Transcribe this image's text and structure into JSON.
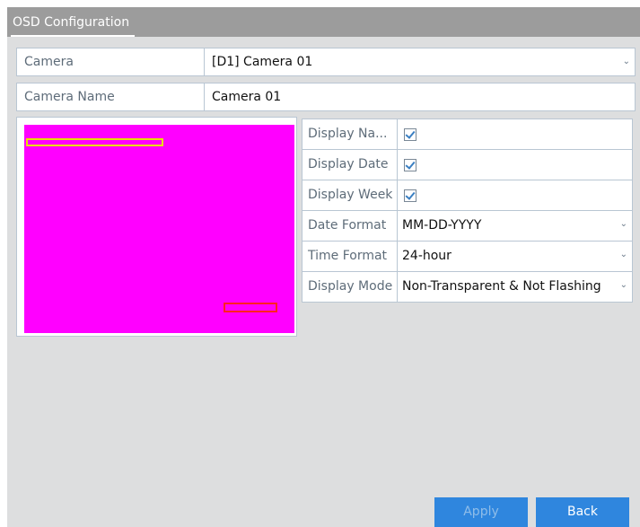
{
  "title": "OSD Configuration",
  "camera": {
    "label": "Camera",
    "value": "[D1] Camera 01"
  },
  "camera_name": {
    "label": "Camera Name",
    "value": "Camera 01"
  },
  "settings": {
    "display_name": {
      "label": "Display Na...",
      "checked": true
    },
    "display_date": {
      "label": "Display Date",
      "checked": true
    },
    "display_week": {
      "label": "Display Week",
      "checked": true
    },
    "date_format": {
      "label": "Date Format",
      "value": "MM-DD-YYYY"
    },
    "time_format": {
      "label": "Time Format",
      "value": "24-hour"
    },
    "display_mode": {
      "label": "Display Mode",
      "value": "Non-Transparent & Not Flashing"
    }
  },
  "buttons": {
    "apply": "Apply",
    "back": "Back"
  },
  "colors": {
    "preview_bg": "#ff00ff",
    "osd_name_box": "#e7e000",
    "osd_date_box": "#ff2020",
    "button_bg": "#2f86de"
  },
  "icons": {
    "dropdown": "chevron-down-icon",
    "checkbox": "checkmark-icon"
  }
}
